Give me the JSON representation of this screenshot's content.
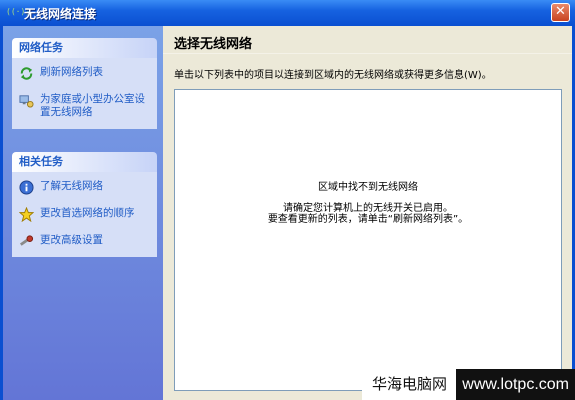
{
  "window": {
    "title": "无线网络连接",
    "close_symbol": "✕"
  },
  "sidebar": {
    "network_tasks": {
      "heading": "网络任务",
      "items": [
        {
          "label": "刷新网络列表",
          "icon": "refresh-icon"
        },
        {
          "label": "为家庭或小型办公室设置无线网络",
          "icon": "setup-network-icon"
        }
      ]
    },
    "related_tasks": {
      "heading": "相关任务",
      "items": [
        {
          "label": "了解无线网络",
          "icon": "info-icon"
        },
        {
          "label": "更改首选网络的顺序",
          "icon": "star-icon"
        },
        {
          "label": "更改高级设置",
          "icon": "settings-icon"
        }
      ]
    }
  },
  "main": {
    "heading": "选择无线网络",
    "instruction": "单击以下列表中的项目以连接到区域内的无线网络或获得更多信息(W)。",
    "list": {
      "empty_title": "区域中找不到无线网络",
      "empty_line1": "请确定您计算机上的无线开关已启用。",
      "empty_line2": "要查看更新的列表，请单击“刷新网络列表”。"
    }
  },
  "watermark": {
    "cn": "华海电脑网",
    "url": "www.lotpc.com"
  },
  "colors": {
    "title_bar": "#0a4fd1",
    "sidebar_bg": "#6f8ee0",
    "task_link": "#215dc6",
    "content_bg": "#ece9d8"
  }
}
